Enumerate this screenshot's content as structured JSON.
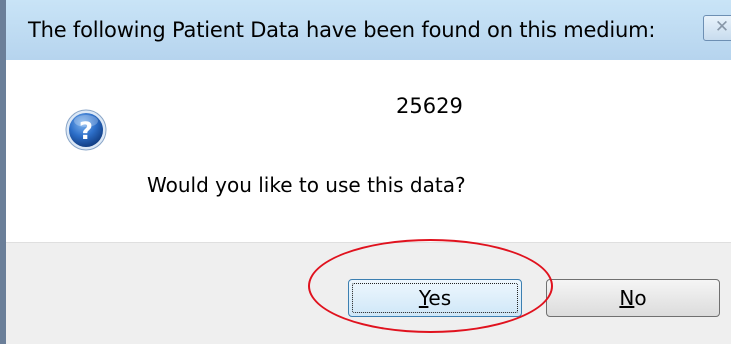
{
  "dialog": {
    "title": "The following Patient Data have been found on this medium:",
    "patient_id": "25629",
    "prompt": "Would you like to use this data?",
    "icon": "question-icon"
  },
  "buttons": {
    "yes": {
      "mnemonic": "Y",
      "rest": "es"
    },
    "no": {
      "mnemonic": "N",
      "rest": "o"
    }
  },
  "colors": {
    "title_bar": "#c9e4f7",
    "button_area": "#efefef",
    "default_button_border": "#3c7fb1",
    "annotation": "#e0121e"
  }
}
